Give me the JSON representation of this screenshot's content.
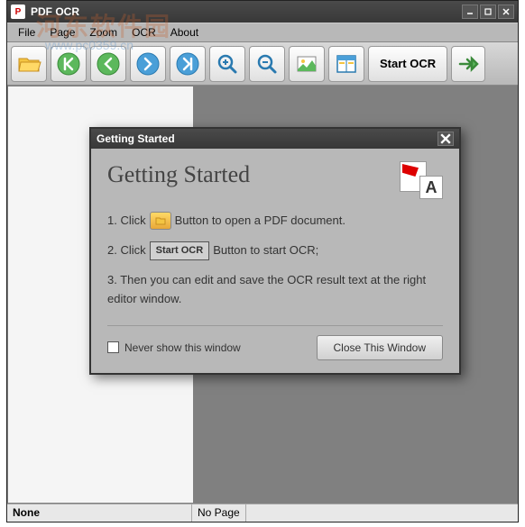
{
  "app": {
    "title": "PDF OCR"
  },
  "menu": {
    "file": "File",
    "page": "Page",
    "zoom": "Zoom",
    "ocr": "OCR",
    "about": "About"
  },
  "toolbar": {
    "start_ocr": "Start OCR"
  },
  "status": {
    "left": "None",
    "right": "No Page"
  },
  "dialog": {
    "title": "Getting Started",
    "heading": "Getting Started",
    "step1_pre": "1. Click",
    "step1_post": "Button to open a PDF document.",
    "step2_pre": "2. Click",
    "step2_btn": "Start OCR",
    "step2_post": "Button to start OCR;",
    "step3": "3. Then you can edit and save the OCR result text at the right editor window.",
    "never_show": "Never show this window",
    "close_btn": "Close This Window",
    "logo_letter": "A"
  },
  "watermark": {
    "main": "河东软件园",
    "url": "www.pc0359.cn"
  }
}
